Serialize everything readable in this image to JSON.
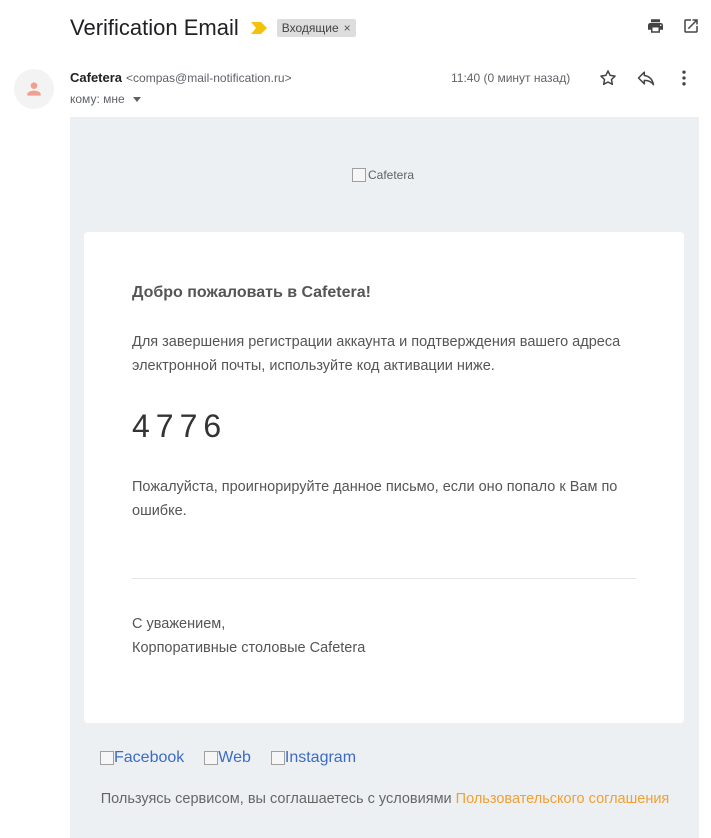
{
  "header": {
    "subject": "Verification Email",
    "label": "Входящие",
    "label_close": "×"
  },
  "sender": {
    "name": "Cafetera",
    "email": "<compas@mail-notification.ru>",
    "to": "кому: мне",
    "time": "11:40 (0 минут назад)"
  },
  "email": {
    "logo_alt": "Cafetera",
    "title": "Добро пожаловать в Cafetera!",
    "intro": "Для завершения регистрации аккаунта и подтверждения вашего адреса электронной почты, используйте код активации ниже.",
    "code": "4776",
    "ignore_text": "Пожалуйста, проигнорируйте данное письмо, если оно попало к Вам по ошибке.",
    "signoff_1": "С уважением,",
    "signoff_2": "Корпоративные столовые Cafetera"
  },
  "footer": {
    "social": [
      "Facebook",
      "Web",
      "Instagram"
    ],
    "terms_text": "Пользуясь сервисом, вы соглашаетесь с условиями ",
    "terms_link": "Пользовательского соглашения"
  },
  "colors": {
    "importance": "#f4c20d",
    "link": "#3b6cc4",
    "terms_link": "#f0a030",
    "body_bg": "#edf0f3"
  }
}
